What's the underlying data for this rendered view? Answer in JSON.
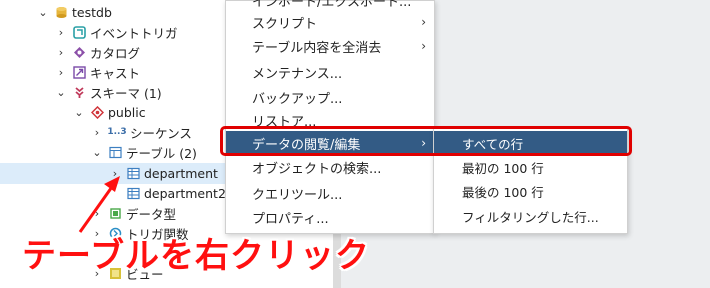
{
  "tree": {
    "items": [
      {
        "label": "testdb",
        "chevron": "v",
        "icon": "database-icon"
      },
      {
        "label": "イベントトリガ",
        "chevron": ">",
        "icon": "event-trigger-icon"
      },
      {
        "label": "カタログ",
        "chevron": ">",
        "icon": "catalog-icon"
      },
      {
        "label": "キャスト",
        "chevron": ">",
        "icon": "cast-icon"
      },
      {
        "label": "スキーマ (1)",
        "chevron": "v",
        "icon": "schema-icon"
      },
      {
        "label": "public",
        "chevron": "v",
        "icon": "public-schema-icon"
      },
      {
        "label": "シーケンス",
        "chevron": ">",
        "icon": "sequence-icon",
        "icon_text": "1..3"
      },
      {
        "label": "テーブル (2)",
        "chevron": "v",
        "icon": "tables-icon"
      },
      {
        "label": "department",
        "chevron": ">",
        "icon": "table-icon"
      },
      {
        "label": "department2",
        "chevron": "",
        "icon": "table-icon"
      },
      {
        "label": "データ型",
        "chevron": ">",
        "icon": "datatype-icon"
      },
      {
        "label": "トリガ関数",
        "chevron": ">",
        "icon": "trigger-function-icon"
      },
      {
        "label": "ビュー",
        "chevron": ">",
        "icon": "view-icon"
      }
    ]
  },
  "context_menu": {
    "items": [
      {
        "label": "インポート/エクスポート...",
        "submenu": false
      },
      {
        "label": "スクリプト",
        "submenu": true
      },
      {
        "label": "テーブル内容を全消去",
        "submenu": true
      },
      {
        "label": "メンテナンス...",
        "submenu": false
      },
      {
        "label": "バックアップ...",
        "submenu": false
      },
      {
        "label": "リストア...",
        "submenu": false
      },
      {
        "label": "データの閲覧/編集",
        "submenu": true
      },
      {
        "label": "オブジェクトの検索...",
        "submenu": false
      },
      {
        "label": "クエリツール...",
        "submenu": false
      },
      {
        "label": "プロパティ...",
        "submenu": false
      }
    ],
    "submenu_arrow": "›"
  },
  "submenu": {
    "items": [
      {
        "label": "すべての行"
      },
      {
        "label": "最初の 100 行"
      },
      {
        "label": "最後の 100 行"
      },
      {
        "label": "フィルタリングした行..."
      }
    ]
  },
  "annotation": {
    "text": "テーブルを右クリック",
    "color": "#ff1010"
  },
  "colors": {
    "menu_active": "#335b85",
    "highlight_border": "#e00000",
    "selected_row": "#dcecfa"
  }
}
